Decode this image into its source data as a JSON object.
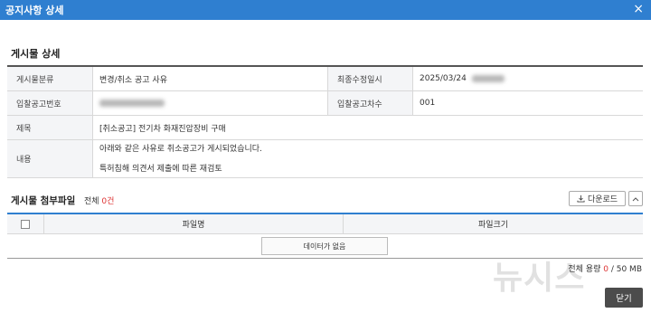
{
  "dialog": {
    "title": "공지사항 상세",
    "close_icon": "×"
  },
  "detail": {
    "section_title": "게시물 상세",
    "category_label": "게시물분류",
    "category_value": "변경/취소 공고 사유",
    "modified_label": "최종수정일시",
    "modified_value": "2025/03/24",
    "bid_no_label": "입찰공고번호",
    "bid_round_label": "입찰공고차수",
    "bid_round_value": "001",
    "subject_label": "제목",
    "subject_value": "[취소공고] 전기차 화재진압장비 구매",
    "content_label": "내용",
    "content_line1": "아래와 같은 사유로 취소공고가 게시되었습니다.",
    "content_line2": "특허침해 의견서 제출에 따른 재검토"
  },
  "attachments": {
    "title": "게시물 첨부파일",
    "total_prefix": "전체 ",
    "total_count": "0건",
    "download_label": "다운로드",
    "columns": [
      "파일명",
      "파일크기"
    ],
    "empty_text": "데이터가 없음",
    "capacity_prefix": "전체 용량 ",
    "capacity_used": "0",
    "capacity_sep": " / ",
    "capacity_max": "50",
    "capacity_unit": " MB"
  },
  "footer": {
    "close_label": "닫기"
  },
  "watermark": "뉴시스"
}
